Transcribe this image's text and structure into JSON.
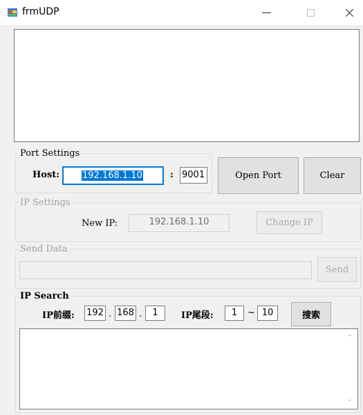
{
  "window": {
    "title": "frmUDP",
    "icon": "app-window-icon",
    "controls": [
      "minimize-icon",
      "maximize-icon",
      "close-icon"
    ]
  },
  "port_settings": {
    "legend": "Port Settings",
    "host_label": "Host:",
    "host_value": "192.168.1.10",
    "colon": ":",
    "port_value": "9001",
    "open_port_label": "Open Port",
    "clear_label": "Clear"
  },
  "ip_settings": {
    "legend": "IP Settings",
    "new_ip_label": "New IP:",
    "new_ip_value": "192.168.1.10",
    "change_ip_label": "Change IP"
  },
  "send_data": {
    "legend": "Send Data",
    "input_value": "",
    "send_label": "Send"
  },
  "ip_search": {
    "legend": "IP Search",
    "prefix_label": "IP前缀:",
    "prefix_1": "192",
    "prefix_2": "168",
    "prefix_3": "1",
    "dot": ".",
    "suffix_label": "IP尾段:",
    "range_start": "1",
    "tilde": "~",
    "range_end": "10",
    "search_label": "搜索"
  },
  "colors": {
    "selection": "#0078d7",
    "window_bg": "#f0f0f0"
  }
}
